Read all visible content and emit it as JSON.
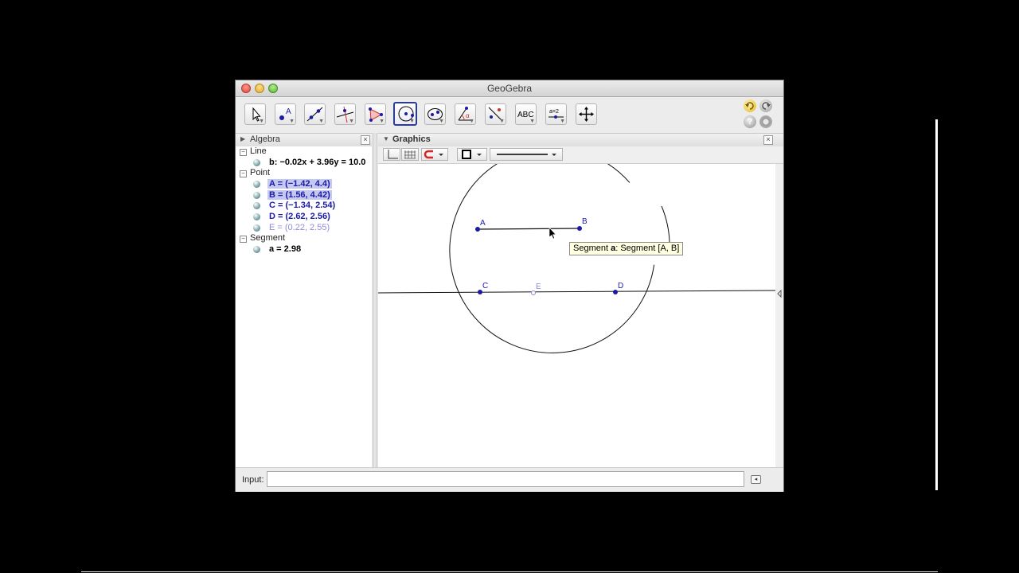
{
  "window": {
    "title": "GeoGebra"
  },
  "toolbar": {
    "tools": [
      {
        "name": "move"
      },
      {
        "name": "point"
      },
      {
        "name": "line"
      },
      {
        "name": "perpendicular"
      },
      {
        "name": "polygon"
      },
      {
        "name": "circle-center-point",
        "selected": true
      },
      {
        "name": "ellipse"
      },
      {
        "name": "angle"
      },
      {
        "name": "reflect"
      },
      {
        "name": "text",
        "label": "ABC"
      },
      {
        "name": "slider",
        "label": "a=2"
      },
      {
        "name": "move-graphics"
      }
    ],
    "undo_icon": "undo-icon",
    "redo_icon": "redo-icon",
    "help_icon": "help-icon",
    "settings_icon": "gear-icon"
  },
  "algebra": {
    "title": "Algebra",
    "close": "×",
    "groups": [
      {
        "label": "Line",
        "toggle": "−",
        "items": [
          {
            "text": "b: −0.02x + 3.96y = 10.0",
            "color": "#000000",
            "selected": false
          }
        ]
      },
      {
        "label": "Point",
        "toggle": "−",
        "items": [
          {
            "text": "A = (−1.42, 4.4)",
            "color": "#1a1aa6",
            "selected": true
          },
          {
            "text": "B = (1.56, 4.42)",
            "color": "#1a1aa6",
            "selected": true
          },
          {
            "text": "C = (−1.34, 2.54)",
            "color": "#1a1aa6",
            "selected": false
          },
          {
            "text": "D = (2.62, 2.56)",
            "color": "#1a1aa6",
            "selected": false
          },
          {
            "text": "E = (0.22, 2.55)",
            "color": "#8c8cd6",
            "selected": false
          }
        ]
      },
      {
        "label": "Segment",
        "toggle": "−",
        "items": [
          {
            "text": "a = 2.98",
            "color": "#000000",
            "selected": false
          }
        ]
      }
    ]
  },
  "graphics": {
    "title": "Graphics",
    "close": "×",
    "labels": {
      "A": "A",
      "B": "B",
      "C": "C",
      "D": "D",
      "E": "E"
    },
    "tooltip_prefix": "Segment ",
    "tooltip_name": "a",
    "tooltip_rest": ": Segment [A, B]"
  },
  "input": {
    "label": "Input:",
    "value": "",
    "button": "◂"
  },
  "colors": {
    "point": "#1a1aa6",
    "point_light": "#8c8cd6",
    "selection": "#c5c9f2",
    "tool_selected": "#2a3d8f"
  }
}
